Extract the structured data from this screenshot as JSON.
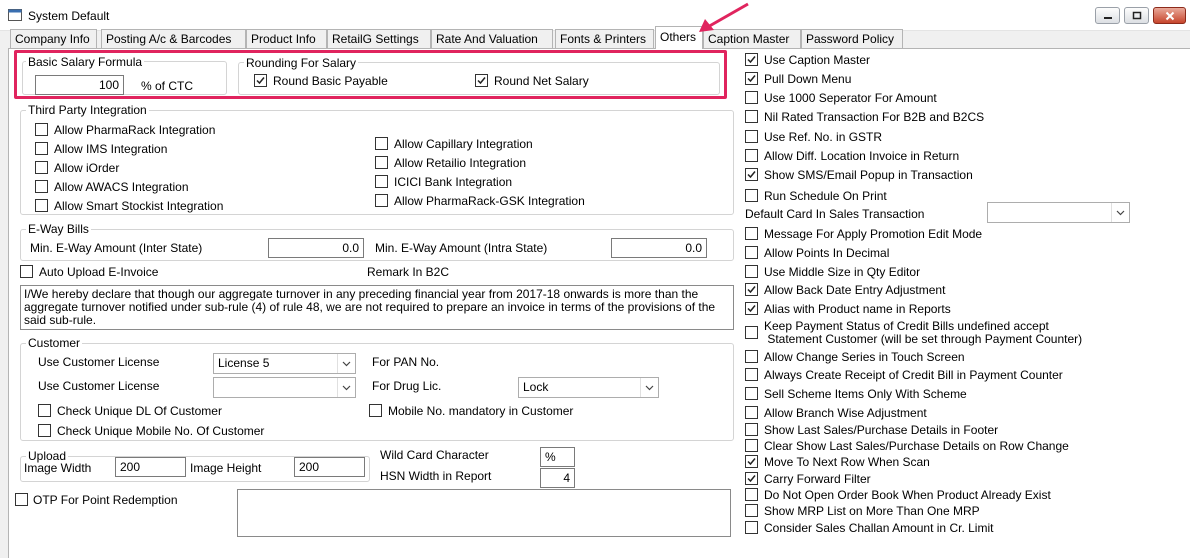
{
  "window": {
    "title": "System Default"
  },
  "tabs": [
    {
      "label": "Company Info"
    },
    {
      "label": "Posting A/c & Barcodes"
    },
    {
      "label": "Product Info"
    },
    {
      "label": "RetailG Settings"
    },
    {
      "label": "Rate And Valuation"
    },
    {
      "label": "Fonts & Printers"
    },
    {
      "label": "Others"
    },
    {
      "label": "Caption Master"
    },
    {
      "label": "Password Policy"
    }
  ],
  "active_tab": "Others",
  "salary": {
    "basic_legend": "Basic Salary Formula",
    "basic_value": "100",
    "basic_unit": "% of CTC",
    "rounding_legend": "Rounding For Salary",
    "round_basic_label": "Round Basic Payable",
    "round_basic_checked": true,
    "round_net_label": "Round Net Salary",
    "round_net_checked": true
  },
  "third_party": {
    "legend": "Third Party Integration",
    "items": [
      {
        "label": "Allow PharmaRack Integration",
        "checked": false
      },
      {
        "label": "Allow IMS Integration",
        "checked": false
      },
      {
        "label": "Allow iOrder",
        "checked": false
      },
      {
        "label": "Allow AWACS Integration",
        "checked": false
      },
      {
        "label": "Allow Smart Stockist Integration",
        "checked": false
      },
      {
        "label": "Allow Capillary Integration",
        "checked": false
      },
      {
        "label": "Allow Retailio Integration",
        "checked": false
      },
      {
        "label": "ICICI Bank Integration",
        "checked": false
      },
      {
        "label": "Allow PharmaRack-GSK Integration",
        "checked": false
      }
    ]
  },
  "eway": {
    "legend": "E-Way Bills",
    "inter_label": "Min. E-Way Amount (Inter State)",
    "inter_value": "0.0",
    "intra_label": "Min. E-Way Amount (Intra State)",
    "intra_value": "0.0"
  },
  "einvoice": {
    "auto_upload_label": "Auto Upload E-Invoice",
    "auto_upload_checked": false,
    "remark_label": "Remark In B2C",
    "remark_text": "I/We hereby declare that though our aggregate turnover in any preceding financial year from 2017-18 onwards is more than the aggregate turnover notified under sub-rule (4) of rule 48, we are not required to prepare an invoice in terms of the provisions of the said sub-rule."
  },
  "customer": {
    "legend": "Customer",
    "license1_label": "Use Customer License",
    "license1_value": "License 5",
    "license2_label": "Use Customer License",
    "license2_value": "",
    "pan_label": "For PAN No.",
    "drug_label": "For Drug Lic.",
    "drug_value": "Lock",
    "check_dl_label": "Check Unique DL Of Customer",
    "check_dl_checked": false,
    "check_mobile_label": "Check Unique Mobile No. Of Customer",
    "check_mobile_checked": false,
    "mobile_mandatory_label": "Mobile No. mandatory in Customer",
    "mobile_mandatory_checked": false
  },
  "upload": {
    "legend": "Upload",
    "width_label": "Image Width",
    "width_value": "200",
    "height_label": "Image Height",
    "height_value": "200"
  },
  "wildcard": {
    "label": "Wild Card Character",
    "value": "%",
    "hsn_label": "HSN Width in Report",
    "hsn_value": "4"
  },
  "otp": {
    "label": "OTP For Point Redemption",
    "checked": false,
    "text": ""
  },
  "right_options": [
    {
      "label": "Use Caption Master",
      "checked": true
    },
    {
      "label": "Pull Down Menu",
      "checked": true
    },
    {
      "label": "Use 1000 Seperator For Amount",
      "checked": false
    },
    {
      "label": "Nil Rated Transaction For B2B and B2CS",
      "checked": false
    },
    {
      "label": "Use Ref. No. in GSTR",
      "checked": false
    },
    {
      "label": "Allow Diff. Location Invoice in Return",
      "checked": false
    },
    {
      "label": "Show SMS/Email Popup in Transaction",
      "checked": true
    },
    {
      "label": "Run Schedule On Print",
      "checked": false
    }
  ],
  "default_card": {
    "label": "Default Card In Sales Transaction",
    "value": ""
  },
  "right_options2": [
    {
      "label": "Message For Apply Promotion Edit Mode",
      "checked": false
    },
    {
      "label": "Allow Points In Decimal",
      "checked": false
    },
    {
      "label": "Use Middle Size in Qty Editor",
      "checked": false
    },
    {
      "label": "Allow Back Date Entry Adjustment",
      "checked": true
    },
    {
      "label": "Alias with Product name in Reports",
      "checked": true
    }
  ],
  "keep_payment": {
    "line1": "Keep Payment Status of Credit Bills undefined accept",
    "line2": " Statement Customer (will be set through Payment Counter)",
    "checked": false
  },
  "right_options3": [
    {
      "label": "Allow Change Series in Touch Screen",
      "checked": false
    },
    {
      "label": "Always Create Receipt of Credit Bill in Payment Counter",
      "checked": false
    },
    {
      "label": "Sell Scheme Items Only With Scheme",
      "checked": false
    },
    {
      "label": "Allow Branch Wise Adjustment",
      "checked": false
    },
    {
      "label": "Show Last Sales/Purchase Details in Footer",
      "checked": false
    },
    {
      "label": "Clear Show Last Sales/Purchase Details on Row Change",
      "checked": false
    },
    {
      "label": "Move To Next Row When Scan",
      "checked": true
    },
    {
      "label": "Carry Forward Filter",
      "checked": true
    },
    {
      "label": "Do Not Open Order Book When Product Already Exist",
      "checked": false
    },
    {
      "label": "Show MRP List on More Than One MRP",
      "checked": false
    },
    {
      "label": "Consider Sales Challan Amount in Cr. Limit",
      "checked": false
    }
  ],
  "colors": {
    "highlight": "#e0245e",
    "arrow": "#e0245e"
  }
}
